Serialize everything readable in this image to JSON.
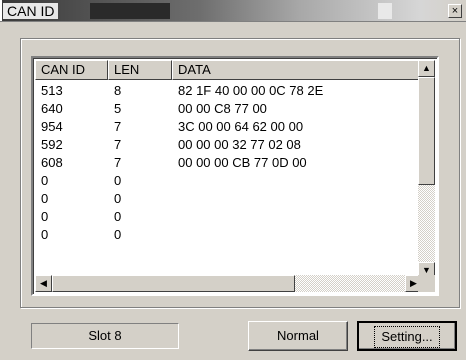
{
  "window": {
    "title": "CAN ID",
    "close_glyph": "×"
  },
  "table": {
    "columns": [
      "CAN ID",
      "LEN",
      "DATA"
    ],
    "rows": [
      [
        "513",
        "8",
        "82 1F 40 00 00 0C 78 2E"
      ],
      [
        "640",
        "5",
        "00 00 C8 77 00"
      ],
      [
        "954",
        "7",
        "3C 00 00 64 62 00 00"
      ],
      [
        "592",
        "7",
        "00 00 00 32 77 02 08"
      ],
      [
        "608",
        "7",
        "00 00 00 CB 77 0D 00"
      ],
      [
        "0",
        "0",
        ""
      ],
      [
        "0",
        "0",
        ""
      ],
      [
        "0",
        "0",
        ""
      ],
      [
        "0",
        "0",
        ""
      ]
    ]
  },
  "scroll": {
    "up": "▲",
    "down": "▼",
    "left": "◀",
    "right": "▶"
  },
  "footer": {
    "status": "Slot 8",
    "mode_label": "Normal",
    "setting_label": "Setting..."
  }
}
